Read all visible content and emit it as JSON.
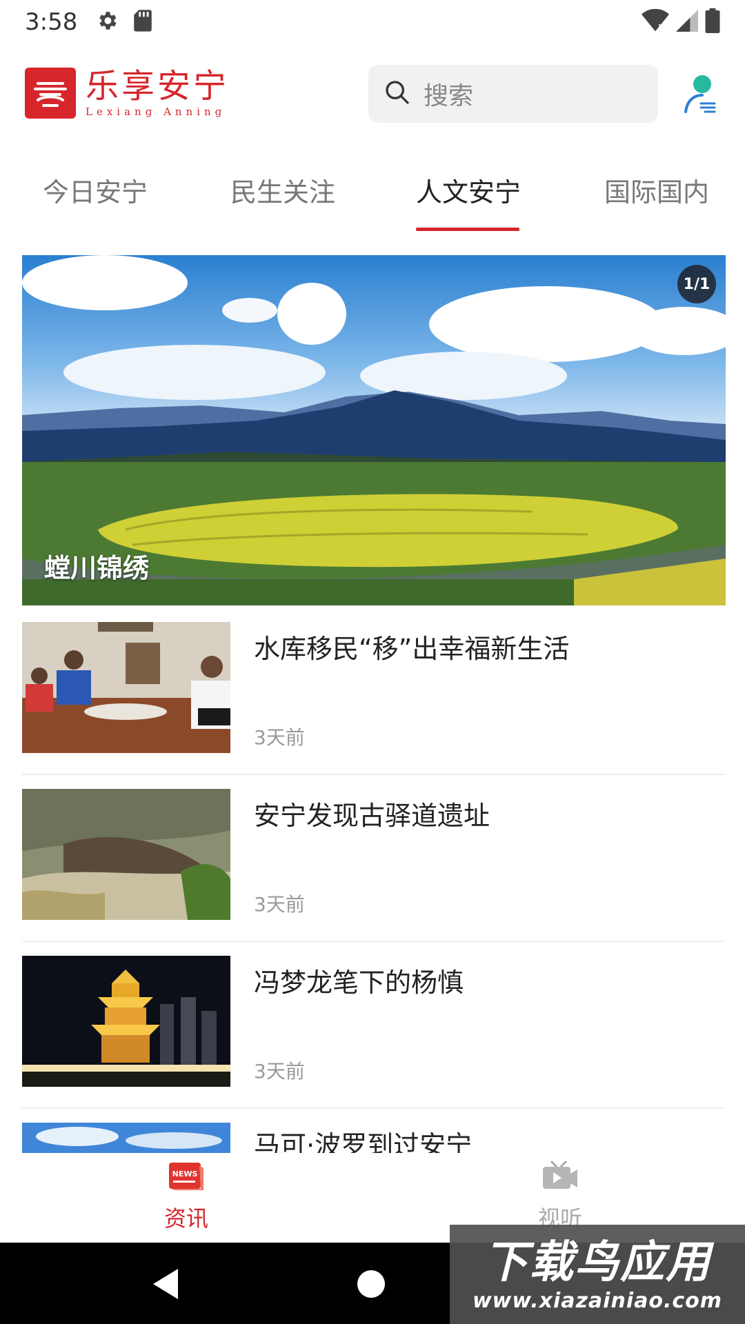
{
  "status_bar": {
    "time": "3:58",
    "icons": [
      "settings-icon",
      "sd-card-icon",
      "wifi-icon",
      "signal-icon",
      "battery-icon"
    ]
  },
  "header": {
    "logo_cn": "乐享安宁",
    "logo_en": "Lexiang Anning",
    "search_placeholder": "搜索",
    "accent_color": "#d6262c"
  },
  "tabs": [
    {
      "label": "今日安宁",
      "active": false
    },
    {
      "label": "民生关注",
      "active": false
    },
    {
      "label": "人文安宁",
      "active": true
    },
    {
      "label": "国际国内",
      "active": false
    }
  ],
  "hero": {
    "counter": "1/1",
    "caption": "螳川锦绣"
  },
  "news": [
    {
      "title": "水库移民“移”出幸福新生活",
      "time": "3天前"
    },
    {
      "title": "安宁发现古驿道遗址",
      "time": "3天前"
    },
    {
      "title": "冯梦龙笔下的杨慎",
      "time": "3天前"
    },
    {
      "title": "马可·波罗到过安宁",
      "time": ""
    }
  ],
  "bottom_nav": [
    {
      "label": "资讯",
      "icon": "news-icon",
      "active": true
    },
    {
      "label": "视听",
      "icon": "video-icon",
      "active": false
    }
  ],
  "watermark": {
    "text": "下载鸟应用",
    "url": "www.xiazainiao.com"
  }
}
